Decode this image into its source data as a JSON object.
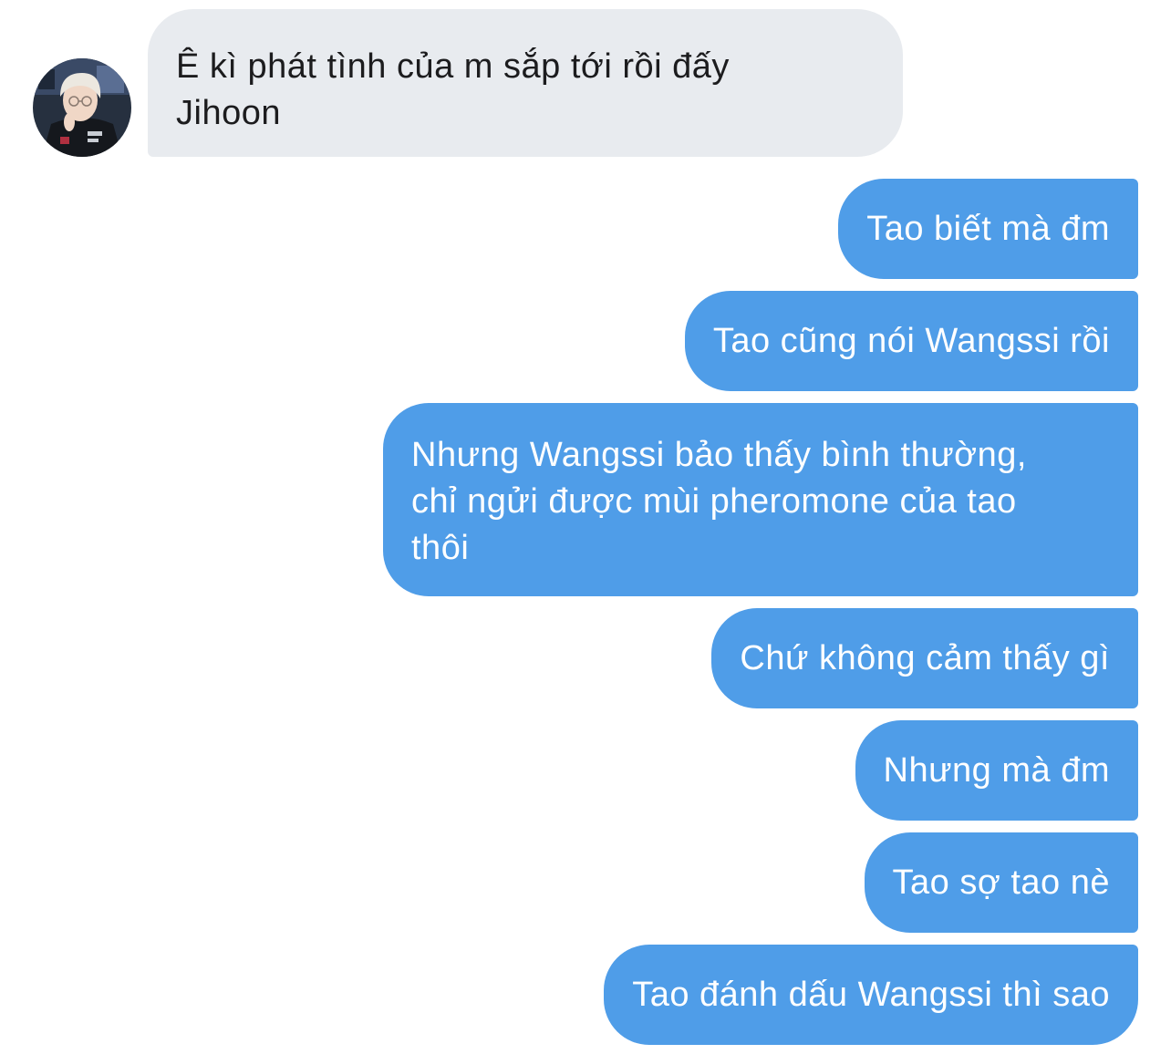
{
  "conversation": {
    "contact": {
      "avatar_icon": "contact-avatar"
    },
    "incoming": [
      {
        "line1": "Ê kì phát tình của m sắp tới rồi đấy",
        "line2": "Jihoon"
      }
    ],
    "outgoing": [
      "Tao biết mà đm",
      "Tao cũng nói Wangssi rồi",
      {
        "line1": "Nhưng Wangssi bảo thấy bình thường,",
        "line2": "chỉ ngửi được mùi pheromone của tao",
        "line3": "thôi"
      },
      "Chứ không cảm thấy gì",
      "Nhưng mà đm",
      "Tao sợ tao nè",
      "Tao đánh dấu Wangssi thì sao"
    ]
  },
  "colors": {
    "incoming_bubble": "#e8ebef",
    "outgoing_bubble": "#4f9de8",
    "incoming_text": "#1c1c1e",
    "outgoing_text": "#ffffff"
  }
}
